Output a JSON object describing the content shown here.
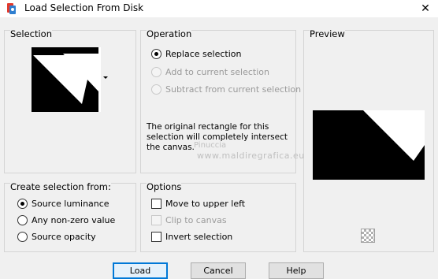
{
  "window": {
    "title": "Load Selection From Disk",
    "close_glyph": "✕"
  },
  "selection": {
    "label": "Selection"
  },
  "operation": {
    "label": "Operation",
    "options": [
      {
        "label": "Replace selection",
        "checked": true,
        "enabled": true
      },
      {
        "label": "Add to current selection",
        "checked": false,
        "enabled": false
      },
      {
        "label": "Subtract from current selection",
        "checked": false,
        "enabled": false
      }
    ],
    "info_text": "The original rectangle for this selection will completely intersect the canvas."
  },
  "preview": {
    "label": "Preview"
  },
  "create_from": {
    "label": "Create selection from:",
    "options": [
      {
        "label": "Source luminance",
        "checked": true
      },
      {
        "label": "Any non-zero value",
        "checked": false
      },
      {
        "label": "Source opacity",
        "checked": false
      }
    ]
  },
  "options": {
    "label": "Options",
    "items": [
      {
        "label": "Move to upper left",
        "checked": false,
        "enabled": true
      },
      {
        "label": "Clip to canvas",
        "checked": false,
        "enabled": false
      },
      {
        "label": "Invert selection",
        "checked": false,
        "enabled": true
      }
    ]
  },
  "watermark": {
    "name": "Pinuccia",
    "url": "www.maldiregrafica.eu"
  },
  "buttons": {
    "load": "Load",
    "cancel": "Cancel",
    "help": "Help"
  },
  "colors": {
    "default_button_border": "#0078d7",
    "dialog_bg": "#f0f0f0"
  }
}
